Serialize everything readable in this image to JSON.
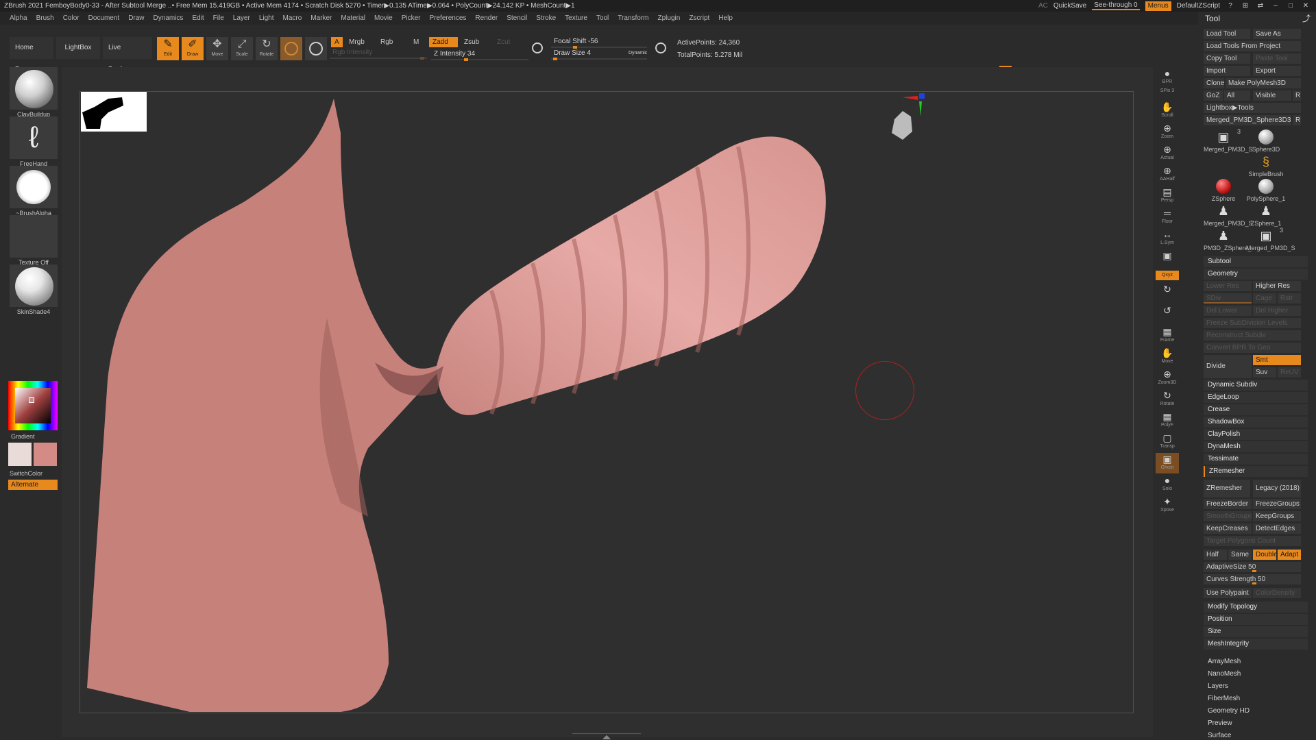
{
  "titlebar": {
    "text": "ZBrush 2021   FemboyBody0-33 - After Subtool Merge   ..• Free Mem 15.419GB • Active Mem 4174 • Scratch Disk 5270 •  Timer▶0.135 ATime▶0.064 • PolyCount▶24.142 KP  • MeshCount▶1",
    "ac": "AC",
    "quicksave": "QuickSave",
    "seethrough": "See-through  0",
    "menus": "Menus",
    "script": "DefaultZScript"
  },
  "menubar": [
    "Alpha",
    "Brush",
    "Color",
    "Document",
    "Draw",
    "Dynamics",
    "Edit",
    "File",
    "Layer",
    "Light",
    "Macro",
    "Marker",
    "Material",
    "Movie",
    "Picker",
    "Preferences",
    "Render",
    "Stencil",
    "Stroke",
    "Texture",
    "Tool",
    "Transform",
    "Zplugin",
    "Zscript",
    "Help"
  ],
  "shelf": {
    "home": "Home Page",
    "lightbox": "LightBox",
    "liveboolean": "Live Boolean",
    "edit": "Edit",
    "draw": "Draw",
    "move": "Move",
    "scale": "Scale",
    "rotate": "Rotate",
    "a": "A",
    "mrgb": "Mrgb",
    "rgb": "Rgb",
    "m": "M",
    "zadd": "Zadd",
    "zsub": "Zsub",
    "zcut": "Zcut",
    "rgb_intensity": "Rgb Intensity",
    "z_intensity": "Z Intensity 34",
    "z_intensity_value": 34,
    "focal_shift": "Focal Shift -56",
    "draw_size": "Draw Size 4",
    "dynamic": "Dynamic",
    "active_points": "ActivePoints: 24,360",
    "total_points": "TotalPoints: 5.278 Mil"
  },
  "left": {
    "brush": "ClayBuildup",
    "stroke": "FreeHand",
    "alpha": "~BrushAlpha",
    "texture": "Texture Off",
    "material": "SkinShade4",
    "gradient": "Gradient",
    "switchcolor": "SwitchColor",
    "alternate": "Alternate",
    "color_main": "#e9dbd8",
    "color_secondary": "#d48b86"
  },
  "rshelf": [
    {
      "name": "bpr",
      "label": "BPR",
      "icon": "●"
    },
    {
      "name": "spix",
      "label": "SPix 3",
      "icon": ""
    },
    {
      "name": "scroll",
      "label": "Scroll",
      "icon": "✋"
    },
    {
      "name": "zoom",
      "label": "Zoom",
      "icon": "⊕"
    },
    {
      "name": "actual",
      "label": "Actual",
      "icon": "⊕"
    },
    {
      "name": "aahalf",
      "label": "AAHalf",
      "icon": "⊕"
    },
    {
      "name": "persp",
      "label": "Persp",
      "icon": "▤"
    },
    {
      "name": "floor",
      "label": "Floor",
      "icon": "═"
    },
    {
      "name": "lsym",
      "label": "L.Sym",
      "icon": "↔"
    },
    {
      "name": "lock",
      "label": "",
      "icon": "▣"
    },
    {
      "name": "xyz",
      "label": "Qxyz",
      "icon": ""
    },
    {
      "name": "rot1",
      "label": "",
      "icon": "↻"
    },
    {
      "name": "rot2",
      "label": "",
      "icon": "↺"
    },
    {
      "name": "frame",
      "label": "Frame",
      "icon": "▦"
    },
    {
      "name": "move",
      "label": "Move",
      "icon": "✋"
    },
    {
      "name": "zoom3d",
      "label": "Zoom3D",
      "icon": "⊕"
    },
    {
      "name": "rotate",
      "label": "Rotate",
      "icon": "↻"
    },
    {
      "name": "polyf",
      "label": "PolyF",
      "icon": "▦"
    },
    {
      "name": "transp",
      "label": "Transp",
      "icon": "▢"
    },
    {
      "name": "ghost",
      "label": "Ghost",
      "icon": "▣"
    },
    {
      "name": "solo",
      "label": "Solo",
      "icon": "●"
    },
    {
      "name": "xpose",
      "label": "Xpose",
      "icon": "✦"
    }
  ],
  "tool": {
    "title": "Tool",
    "load_tool": "Load Tool",
    "save_as": "Save As",
    "load_from_project": "Load Tools From Project",
    "copy_tool": "Copy Tool",
    "paste_tool": "Paste Tool",
    "import": "Import",
    "export": "Export",
    "clone": "Clone",
    "make_polymesh": "Make PolyMesh3D",
    "goz": "GoZ",
    "all": "All",
    "visible": "Visible",
    "r": "R",
    "lightbox_tools": "Lightbox▶Tools",
    "current_tool": "Merged_PM3D_Sphere3D3.",
    "thumbs": [
      {
        "label": "Merged_PM3D_S",
        "badge": "3"
      },
      {
        "label": "Sphere3D"
      },
      {
        "label": "SimpleBrush"
      },
      {
        "label": "ZSphere"
      },
      {
        "label": "PolySphere_1"
      },
      {
        "label": "Merged_PM3D_S"
      },
      {
        "label": "ZSphere_1"
      },
      {
        "label": "PM3D_ZSphere_"
      },
      {
        "label": "Merged_PM3D_S",
        "badge": "3"
      }
    ],
    "subtool": "Subtool",
    "geometry": "Geometry",
    "lower_res": "Lower Res",
    "higher_res": "Higher Res",
    "sdiv": "SDiv",
    "cage": "Cage",
    "rstr": "Rstr",
    "del_lower": "Del Lower",
    "del_higher": "Del Higher",
    "freeze_subdiv": "Freeze SubDivision Levels",
    "reconstruct": "Reconstruct Subdiv",
    "convert_bpr": "Convert BPR To Geo",
    "divide": "Divide",
    "smt": "Smt",
    "suv": "Suv",
    "reuv": "ReUV",
    "dynamic_subdiv": "Dynamic Subdiv",
    "edgeloop": "EdgeLoop",
    "crease": "Crease",
    "shadowbox": "ShadowBox",
    "claypolish": "ClayPolish",
    "dynamesh": "DynaMesh",
    "tessimate": "Tessimate",
    "zremesher": "ZRemesher",
    "zremesher_btn": "ZRemesher",
    "legacy": "Legacy (2018)",
    "freezeborder": "FreezeBorder",
    "freezegroups": "FreezeGroups",
    "smoothgroups": "SmoothGroups",
    "keepgroups": "KeepGroups",
    "keepcreases": "KeepCreases",
    "detectedges": "DetectEdges",
    "target_poly": "Target Polygons Count",
    "half": "Half",
    "same": "Same",
    "double": "Double",
    "adapt": "Adapt",
    "adaptivesize": "AdaptiveSize 50",
    "adaptivesize_value": 50,
    "curves_strength": "Curves Strength 50",
    "curves_strength_value": 50,
    "use_polypaint": "Use Polypaint",
    "colordensity": "ColorDensity",
    "modify_topology": "Modify Topology",
    "position": "Position",
    "size": "Size",
    "meshintegrity": "MeshIntegrity",
    "arraymesh": "ArrayMesh",
    "nanomesh": "NanoMesh",
    "layers": "Layers",
    "fibermesh": "FiberMesh",
    "geometry_hd": "Geometry HD",
    "preview": "Preview",
    "surface": "Surface"
  },
  "colors": {
    "accent": "#e8891e",
    "skin": "#d89590",
    "cursor": "#b02020"
  }
}
